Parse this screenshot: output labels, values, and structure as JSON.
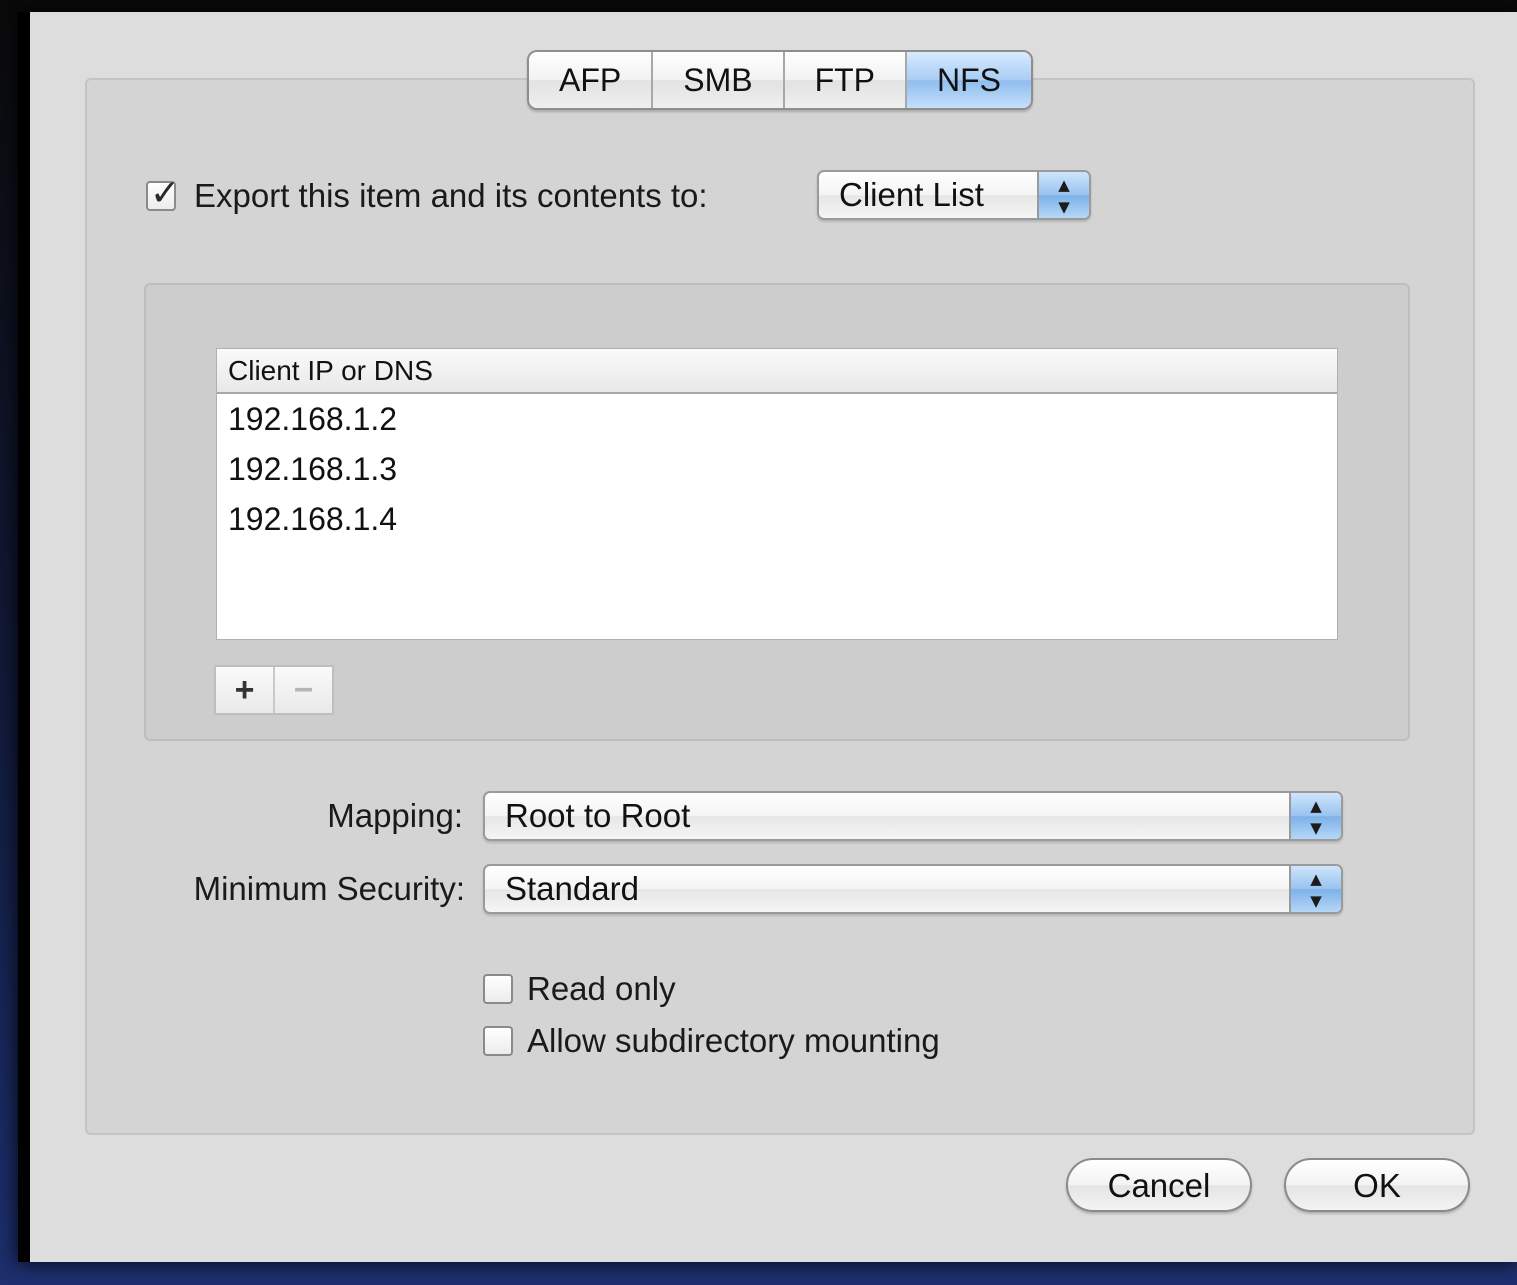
{
  "tabs": [
    {
      "label": "AFP",
      "selected": false
    },
    {
      "label": "SMB",
      "selected": false
    },
    {
      "label": "FTP",
      "selected": false
    },
    {
      "label": "NFS",
      "selected": true
    }
  ],
  "export": {
    "checked": true,
    "label": "Export this item and its contents to:",
    "target_value": "Client List"
  },
  "client_table": {
    "header": "Client IP or DNS",
    "rows": [
      "192.168.1.2",
      "192.168.1.3",
      "192.168.1.4"
    ]
  },
  "list_buttons": {
    "add": "+",
    "remove": "−"
  },
  "mapping": {
    "label": "Mapping:",
    "value": "Root to Root"
  },
  "security": {
    "label": "Minimum Security:",
    "value": "Standard"
  },
  "options": {
    "read_only": {
      "label": "Read only",
      "checked": false
    },
    "subdir": {
      "label": "Allow subdirectory mounting",
      "checked": false
    }
  },
  "buttons": {
    "cancel": "Cancel",
    "ok": "OK"
  },
  "colors": {
    "selected_tab": "#a8cdf4",
    "popup_arrows": "#98c3ef",
    "dialog_bg": "#dddddd"
  },
  "icons": {
    "popup_arrows": "up-down-arrows-icon",
    "checkmark": "checkmark-icon"
  }
}
